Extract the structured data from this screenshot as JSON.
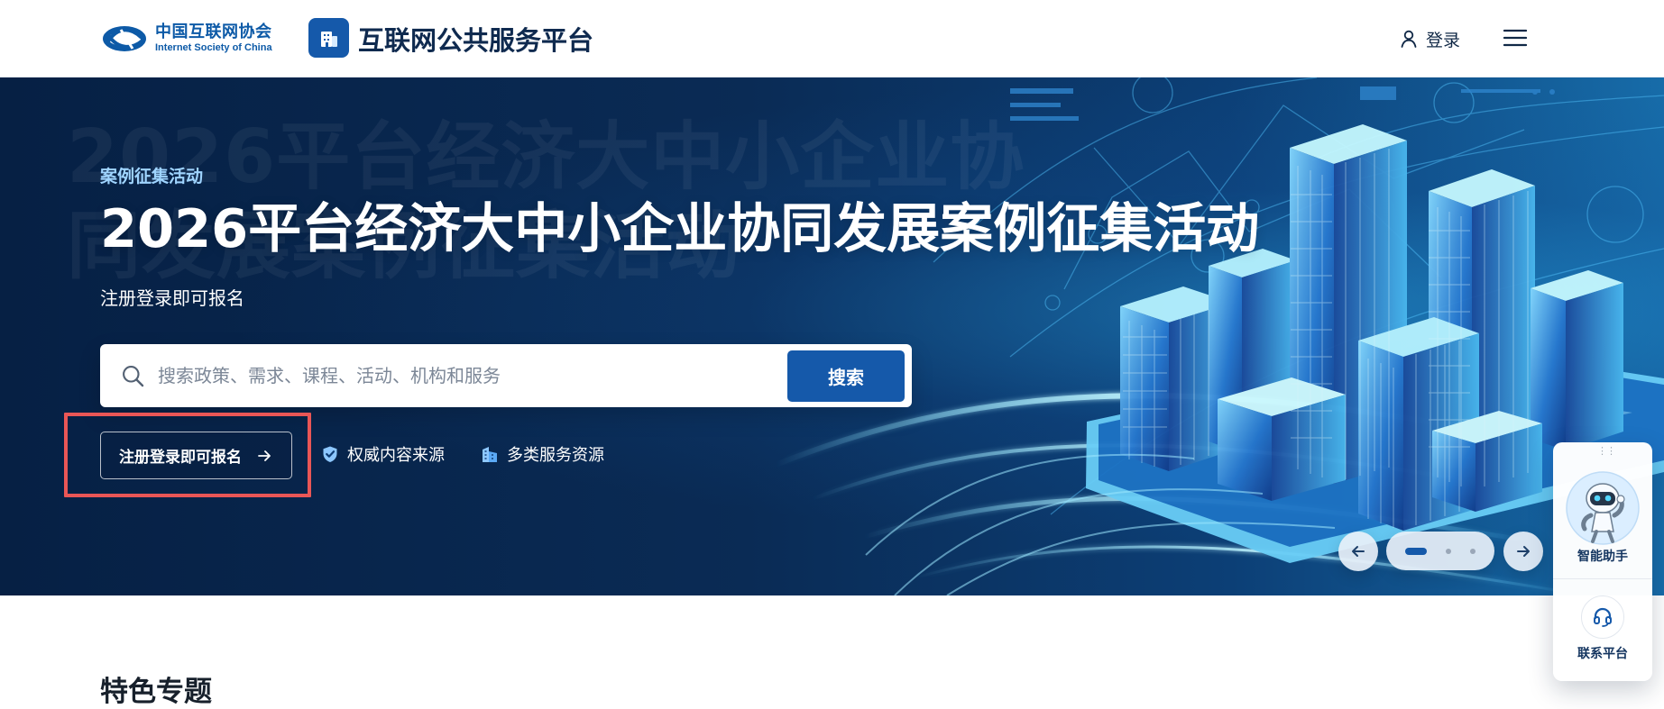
{
  "header": {
    "brand": {
      "name_cn": "中国互联网协会",
      "name_en": "Internet Society of China",
      "platform_name": "互联网公共服务平台",
      "emblem_icon": "internet-society-emblem",
      "platform_icon": "building-icon"
    },
    "login": {
      "label": "登录",
      "icon": "user-icon"
    },
    "menu": {
      "icon": "hamburger-menu-icon"
    }
  },
  "hero": {
    "background_text": "2026平台经济大中小企业协同发展案例征集活动",
    "eyebrow": "案例征集活动",
    "title": "2026平台经济大中小企业协同发展案例征集活动",
    "subtitle": "注册登录即可报名",
    "search": {
      "placeholder": "搜索政策、需求、课程、活动、机构和服务",
      "value": "",
      "button_label": "搜索",
      "icon": "search-icon"
    },
    "cta": {
      "label": "注册登录即可报名",
      "icon": "arrow-right-icon",
      "highlight_color": "#e95656"
    },
    "features": [
      {
        "label": "权威内容来源",
        "icon": "shield-check-icon"
      },
      {
        "label": "多类服务资源",
        "icon": "buildings-icon"
      }
    ],
    "carousel": {
      "previous_icon": "arrow-left-icon",
      "next_icon": "arrow-right-icon",
      "current_slide": 1,
      "slide_count": 3
    }
  },
  "side_panel": {
    "assistant": {
      "label": "智能助手",
      "icon": "robot-assistant-icon"
    },
    "contact": {
      "label": "联系平台",
      "icon": "headset-icon"
    },
    "drag_icon": "drag-handle-icon"
  },
  "main": {
    "section_title": "特色专题"
  },
  "colors": {
    "primary": "#1559aa",
    "hero_dark": "#062044",
    "hero_cyan": "#2aa6e7",
    "highlight": "#e95656"
  }
}
